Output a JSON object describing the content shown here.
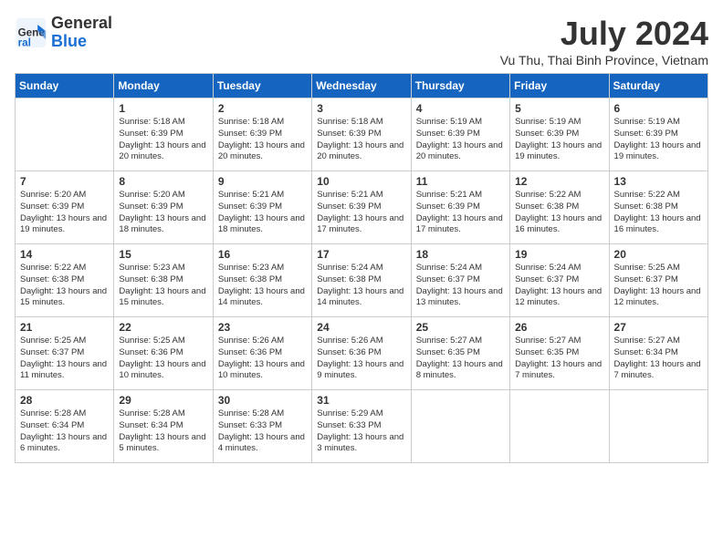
{
  "header": {
    "logo_general": "General",
    "logo_blue": "Blue",
    "month_year": "July 2024",
    "location": "Vu Thu, Thai Binh Province, Vietnam"
  },
  "weekdays": [
    "Sunday",
    "Monday",
    "Tuesday",
    "Wednesday",
    "Thursday",
    "Friday",
    "Saturday"
  ],
  "weeks": [
    [
      {
        "day": "",
        "sunrise": "",
        "sunset": "",
        "daylight": ""
      },
      {
        "day": "1",
        "sunrise": "Sunrise: 5:18 AM",
        "sunset": "Sunset: 6:39 PM",
        "daylight": "Daylight: 13 hours and 20 minutes."
      },
      {
        "day": "2",
        "sunrise": "Sunrise: 5:18 AM",
        "sunset": "Sunset: 6:39 PM",
        "daylight": "Daylight: 13 hours and 20 minutes."
      },
      {
        "day": "3",
        "sunrise": "Sunrise: 5:18 AM",
        "sunset": "Sunset: 6:39 PM",
        "daylight": "Daylight: 13 hours and 20 minutes."
      },
      {
        "day": "4",
        "sunrise": "Sunrise: 5:19 AM",
        "sunset": "Sunset: 6:39 PM",
        "daylight": "Daylight: 13 hours and 20 minutes."
      },
      {
        "day": "5",
        "sunrise": "Sunrise: 5:19 AM",
        "sunset": "Sunset: 6:39 PM",
        "daylight": "Daylight: 13 hours and 19 minutes."
      },
      {
        "day": "6",
        "sunrise": "Sunrise: 5:19 AM",
        "sunset": "Sunset: 6:39 PM",
        "daylight": "Daylight: 13 hours and 19 minutes."
      }
    ],
    [
      {
        "day": "7",
        "sunrise": "Sunrise: 5:20 AM",
        "sunset": "Sunset: 6:39 PM",
        "daylight": "Daylight: 13 hours and 19 minutes."
      },
      {
        "day": "8",
        "sunrise": "Sunrise: 5:20 AM",
        "sunset": "Sunset: 6:39 PM",
        "daylight": "Daylight: 13 hours and 18 minutes."
      },
      {
        "day": "9",
        "sunrise": "Sunrise: 5:21 AM",
        "sunset": "Sunset: 6:39 PM",
        "daylight": "Daylight: 13 hours and 18 minutes."
      },
      {
        "day": "10",
        "sunrise": "Sunrise: 5:21 AM",
        "sunset": "Sunset: 6:39 PM",
        "daylight": "Daylight: 13 hours and 17 minutes."
      },
      {
        "day": "11",
        "sunrise": "Sunrise: 5:21 AM",
        "sunset": "Sunset: 6:39 PM",
        "daylight": "Daylight: 13 hours and 17 minutes."
      },
      {
        "day": "12",
        "sunrise": "Sunrise: 5:22 AM",
        "sunset": "Sunset: 6:38 PM",
        "daylight": "Daylight: 13 hours and 16 minutes."
      },
      {
        "day": "13",
        "sunrise": "Sunrise: 5:22 AM",
        "sunset": "Sunset: 6:38 PM",
        "daylight": "Daylight: 13 hours and 16 minutes."
      }
    ],
    [
      {
        "day": "14",
        "sunrise": "Sunrise: 5:22 AM",
        "sunset": "Sunset: 6:38 PM",
        "daylight": "Daylight: 13 hours and 15 minutes."
      },
      {
        "day": "15",
        "sunrise": "Sunrise: 5:23 AM",
        "sunset": "Sunset: 6:38 PM",
        "daylight": "Daylight: 13 hours and 15 minutes."
      },
      {
        "day": "16",
        "sunrise": "Sunrise: 5:23 AM",
        "sunset": "Sunset: 6:38 PM",
        "daylight": "Daylight: 13 hours and 14 minutes."
      },
      {
        "day": "17",
        "sunrise": "Sunrise: 5:24 AM",
        "sunset": "Sunset: 6:38 PM",
        "daylight": "Daylight: 13 hours and 14 minutes."
      },
      {
        "day": "18",
        "sunrise": "Sunrise: 5:24 AM",
        "sunset": "Sunset: 6:37 PM",
        "daylight": "Daylight: 13 hours and 13 minutes."
      },
      {
        "day": "19",
        "sunrise": "Sunrise: 5:24 AM",
        "sunset": "Sunset: 6:37 PM",
        "daylight": "Daylight: 13 hours and 12 minutes."
      },
      {
        "day": "20",
        "sunrise": "Sunrise: 5:25 AM",
        "sunset": "Sunset: 6:37 PM",
        "daylight": "Daylight: 13 hours and 12 minutes."
      }
    ],
    [
      {
        "day": "21",
        "sunrise": "Sunrise: 5:25 AM",
        "sunset": "Sunset: 6:37 PM",
        "daylight": "Daylight: 13 hours and 11 minutes."
      },
      {
        "day": "22",
        "sunrise": "Sunrise: 5:25 AM",
        "sunset": "Sunset: 6:36 PM",
        "daylight": "Daylight: 13 hours and 10 minutes."
      },
      {
        "day": "23",
        "sunrise": "Sunrise: 5:26 AM",
        "sunset": "Sunset: 6:36 PM",
        "daylight": "Daylight: 13 hours and 10 minutes."
      },
      {
        "day": "24",
        "sunrise": "Sunrise: 5:26 AM",
        "sunset": "Sunset: 6:36 PM",
        "daylight": "Daylight: 13 hours and 9 minutes."
      },
      {
        "day": "25",
        "sunrise": "Sunrise: 5:27 AM",
        "sunset": "Sunset: 6:35 PM",
        "daylight": "Daylight: 13 hours and 8 minutes."
      },
      {
        "day": "26",
        "sunrise": "Sunrise: 5:27 AM",
        "sunset": "Sunset: 6:35 PM",
        "daylight": "Daylight: 13 hours and 7 minutes."
      },
      {
        "day": "27",
        "sunrise": "Sunrise: 5:27 AM",
        "sunset": "Sunset: 6:34 PM",
        "daylight": "Daylight: 13 hours and 7 minutes."
      }
    ],
    [
      {
        "day": "28",
        "sunrise": "Sunrise: 5:28 AM",
        "sunset": "Sunset: 6:34 PM",
        "daylight": "Daylight: 13 hours and 6 minutes."
      },
      {
        "day": "29",
        "sunrise": "Sunrise: 5:28 AM",
        "sunset": "Sunset: 6:34 PM",
        "daylight": "Daylight: 13 hours and 5 minutes."
      },
      {
        "day": "30",
        "sunrise": "Sunrise: 5:28 AM",
        "sunset": "Sunset: 6:33 PM",
        "daylight": "Daylight: 13 hours and 4 minutes."
      },
      {
        "day": "31",
        "sunrise": "Sunrise: 5:29 AM",
        "sunset": "Sunset: 6:33 PM",
        "daylight": "Daylight: 13 hours and 3 minutes."
      },
      {
        "day": "",
        "sunrise": "",
        "sunset": "",
        "daylight": ""
      },
      {
        "day": "",
        "sunrise": "",
        "sunset": "",
        "daylight": ""
      },
      {
        "day": "",
        "sunrise": "",
        "sunset": "",
        "daylight": ""
      }
    ]
  ]
}
